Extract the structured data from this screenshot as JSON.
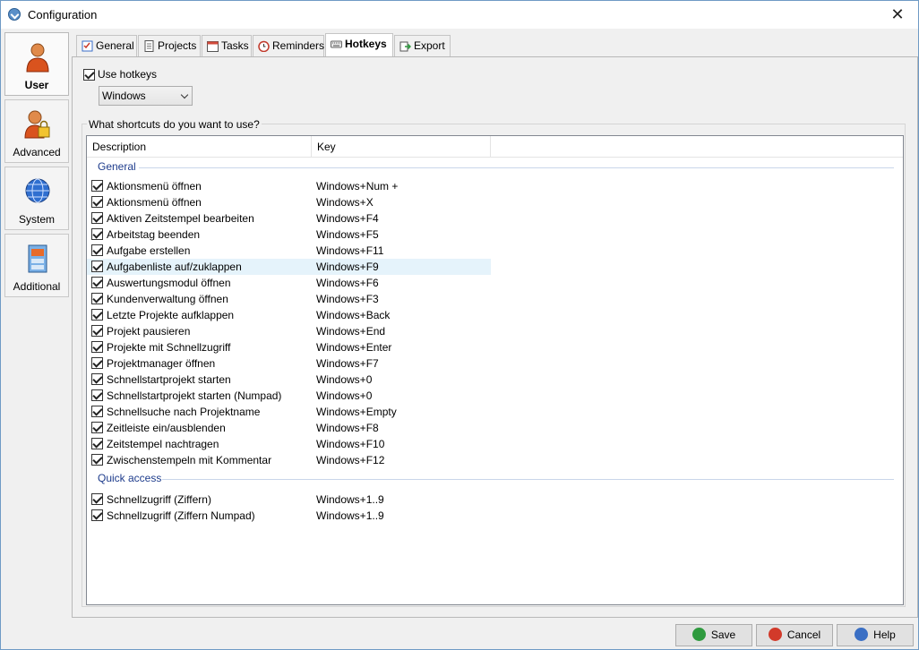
{
  "window": {
    "title": "Configuration",
    "close_glyph": "✕"
  },
  "nav": [
    {
      "label": "User",
      "icon": "user-icon",
      "active": true
    },
    {
      "label": "Advanced",
      "icon": "user-lock-icon",
      "active": false
    },
    {
      "label": "System",
      "icon": "globe-icon",
      "active": false
    },
    {
      "label": "Additional",
      "icon": "cabinet-icon",
      "active": false
    }
  ],
  "tabs": [
    {
      "label": "General",
      "icon": "checklist-icon"
    },
    {
      "label": "Projects",
      "icon": "document-icon"
    },
    {
      "label": "Tasks",
      "icon": "calendar-icon"
    },
    {
      "label": "Reminders",
      "icon": "alarm-clock-icon"
    },
    {
      "label": "Hotkeys",
      "icon": "keyboard-icon",
      "active": true
    },
    {
      "label": "Export",
      "icon": "export-icon"
    }
  ],
  "hotkeys": {
    "use_hotkeys_label": "Use hotkeys",
    "use_hotkeys_checked": true,
    "modifier_selected": "Windows",
    "group_label": "What shortcuts do you want to use?",
    "columns": {
      "description": "Description",
      "key": "Key"
    },
    "sections": [
      {
        "title": "General",
        "rows": [
          {
            "desc": "Aktionsmenü öffnen",
            "key": "Windows+Num +"
          },
          {
            "desc": "Aktionsmenü öffnen",
            "key": "Windows+X"
          },
          {
            "desc": "Aktiven Zeitstempel bearbeiten",
            "key": "Windows+F4"
          },
          {
            "desc": "Arbeitstag beenden",
            "key": "Windows+F5"
          },
          {
            "desc": "Aufgabe erstellen",
            "key": "Windows+F11"
          },
          {
            "desc": "Aufgabenliste auf/zuklappen",
            "key": "Windows+F9",
            "highlighted": true
          },
          {
            "desc": "Auswertungsmodul öffnen",
            "key": "Windows+F6"
          },
          {
            "desc": "Kundenverwaltung öffnen",
            "key": "Windows+F3"
          },
          {
            "desc": "Letzte Projekte aufklappen",
            "key": "Windows+Back"
          },
          {
            "desc": "Projekt pausieren",
            "key": "Windows+End"
          },
          {
            "desc": "Projekte mit Schnellzugriff",
            "key": "Windows+Enter"
          },
          {
            "desc": "Projektmanager öffnen",
            "key": "Windows+F7"
          },
          {
            "desc": "Schnellstartprojekt starten",
            "key": "Windows+0"
          },
          {
            "desc": "Schnellstartprojekt starten (Numpad)",
            "key": "Windows+0"
          },
          {
            "desc": "Schnellsuche nach Projektname",
            "key": "Windows+Empty"
          },
          {
            "desc": "Zeitleiste ein/ausblenden",
            "key": "Windows+F8"
          },
          {
            "desc": "Zeitstempel nachtragen",
            "key": "Windows+F10"
          },
          {
            "desc": "Zwischenstempeln mit Kommentar",
            "key": "Windows+F12"
          }
        ]
      },
      {
        "title": "Quick access",
        "rows": [
          {
            "desc": "Schnellzugriff (Ziffern)",
            "key": "Windows+1..9"
          },
          {
            "desc": "Schnellzugriff (Ziffern Numpad)",
            "key": "Windows+1..9"
          }
        ]
      }
    ]
  },
  "buttons": {
    "save": "Save",
    "cancel": "Cancel",
    "help": "Help"
  },
  "colors": {
    "section_text": "#1e3c8c",
    "row_highlight": "#e5f3fb",
    "save_icon": "#2e9a3e",
    "cancel_icon": "#d23a2a",
    "help_icon": "#3a6fc4"
  }
}
